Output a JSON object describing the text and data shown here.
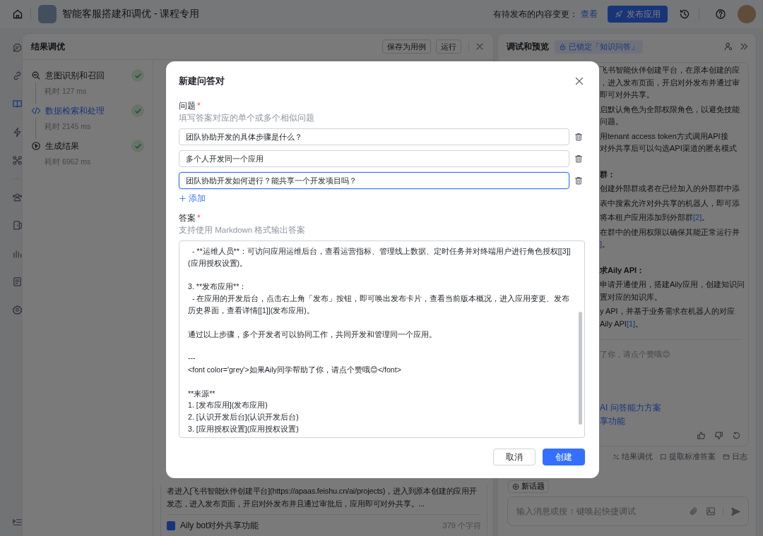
{
  "topbar": {
    "title": "智能客服搭建和调优 - 课程专用",
    "pending_label": "有待发布的内容变更：",
    "view_link": "查看",
    "publish_button": "发布应用"
  },
  "rail": {
    "groups": [
      [
        {
          "kind": "chat",
          "selected": false
        },
        {
          "kind": "link",
          "selected": false
        },
        {
          "kind": "book",
          "selected": true
        },
        {
          "kind": "bolt",
          "selected": false
        },
        {
          "kind": "puzzle",
          "selected": false
        }
      ],
      [
        {
          "kind": "people",
          "selected": false
        },
        {
          "kind": "door",
          "selected": false
        },
        {
          "kind": "chart",
          "selected": false
        },
        {
          "kind": "document",
          "selected": false
        },
        {
          "kind": "gear",
          "selected": false
        }
      ]
    ]
  },
  "tuning_panel": {
    "title": "结果调优",
    "save_button": "保存为用例",
    "run_button": "运行",
    "steps": [
      {
        "kind": "intent",
        "label": "意图识别和召回",
        "time": "耗时 127 ms",
        "done": true,
        "selected": false
      },
      {
        "kind": "retrieval",
        "label": "数据检索和处理",
        "time": "耗时 2145 ms",
        "done": true,
        "selected": true
      },
      {
        "kind": "generate",
        "label": "生成结果",
        "time": "耗时 6962 ms",
        "done": true,
        "selected": false
      }
    ],
    "excerpt": "者进入[飞书智能伙伴创建平台](https://apaas.feishu.cn/ai/projects)，进入到原本创建的应用开发态，进入发布页面，开启对外发布并且通过审批后，应用即可对外共享。...",
    "document": {
      "title": "Aily bot对外共享功能",
      "count": "379 个字符"
    }
  },
  "preview_panel": {
    "title": "调试和预览",
    "lock_badge": "已锁定「知识问答」",
    "paragraphs": [
      {
        "kind": "text",
        "lines": [
          {
            "text": "飞书智能伙伴创建平台，在原本创建的应"
          },
          {
            "text": "，进入发布页面，开启对外发布并通过审"
          },
          {
            "text": "即可对外共享。"
          }
        ]
      },
      {
        "kind": "text",
        "lines": [
          {
            "text": "启默认角色为全部权限角色，以避免技能"
          },
          {
            "text": "问题。"
          }
        ]
      },
      {
        "kind": "text",
        "lines": [
          {
            "text": "用tenant access token方式调用API接"
          },
          {
            "text": "对外共享后可以勾选API渠道的匿名模式"
          }
        ]
      },
      {
        "kind": "heading",
        "lines": [
          {
            "text": "群："
          }
        ]
      },
      {
        "kind": "text",
        "lines": [
          {
            "text": "创建外部群或者在已经加入的外部群中添"
          }
        ]
      },
      {
        "kind": "text",
        "lines": [
          {
            "text": "表中搜索允许对外共享的机器人，即可添"
          }
        ]
      },
      {
        "kind": "text",
        "lines": [
          {
            "text": "将本租户应用添加到外部群",
            "ref": "[2]",
            "tail": "。"
          }
        ]
      },
      {
        "kind": "text",
        "lines": [
          {
            "text": "在群中的使用权限以确保其能正常运行并"
          },
          {
            "ref": "]",
            "tail": "。"
          }
        ]
      },
      {
        "kind": "heading",
        "lines": [
          {
            "text": "求Aily API："
          }
        ]
      },
      {
        "kind": "text",
        "lines": [
          {
            "text": "申请开通使用，搭建Aily应用，创建知识问"
          },
          {
            "text": "置对应的知识库。"
          }
        ]
      },
      {
        "kind": "text",
        "lines": [
          {
            "text": "y API，并基于业务需求在机器人的对应"
          },
          {
            "text": "Aily API",
            "ref": "[1]",
            "tail": "。"
          }
        ]
      },
      {
        "kind": "note",
        "lines": [
          {
            "text": "了你，请点个赞哦😊"
          }
        ]
      }
    ],
    "source_links": [
      "AI 问答能力方案",
      "享功能"
    ],
    "actions": [
      {
        "kind": "tune",
        "label": "结果调优"
      },
      {
        "kind": "extract",
        "label": "提取标准答案"
      },
      {
        "kind": "log",
        "label": "日志"
      }
    ],
    "new_topic_button": "新话题",
    "input": {
      "placeholder": "输入消息或按 ↑ 键唤起快捷调试"
    }
  },
  "modal": {
    "title": "新建问答对",
    "question_label": {
      "text": "问题",
      "required_mark": "*"
    },
    "question_hint": "填写答案对应的单个或多个相似问题",
    "questions": [
      {
        "value": "团队协助开发的具体步骤是什么？",
        "focused": false
      },
      {
        "value": "多个人开发同一个应用",
        "focused": false
      },
      {
        "value": "团队协助开发如何进行？能共享一个开发项目吗？",
        "focused": true
      }
    ],
    "add_button": "添加",
    "answer_label": {
      "text": "答案",
      "required_mark": "*"
    },
    "answer_hint": "支持使用 Markdown 格式输出答案",
    "answer_blocks": [
      [
        "  - **运维人员**：可访问应用运维后台，查看运营指标、管理线上数据、定时任务并对终端用户进行角色授权[[3]](应用授权设置)。"
      ],
      [
        "3. **发布应用**：",
        "  - 在应用的开发后台，点击右上角「发布」按钮，即可唤出发布卡片，查看当前版本概况，进入应用变更、发布历史界面，查看详情[[1]](发布应用)。"
      ],
      [
        "通过以上步骤，多个开发者可以协同工作，共同开发和管理同一个应用。"
      ],
      [
        "---",
        "<font color='grey'>如果Aily同学帮助了你，请点个赞哦😊</font>"
      ],
      [
        "**来源**",
        "1. [发布应用](发布应用)",
        "2. [认识开发后台](认识开发后台)",
        "3. [应用授权设置](应用授权设置)"
      ]
    ],
    "cancel_button": "取消",
    "create_button": "创建"
  }
}
